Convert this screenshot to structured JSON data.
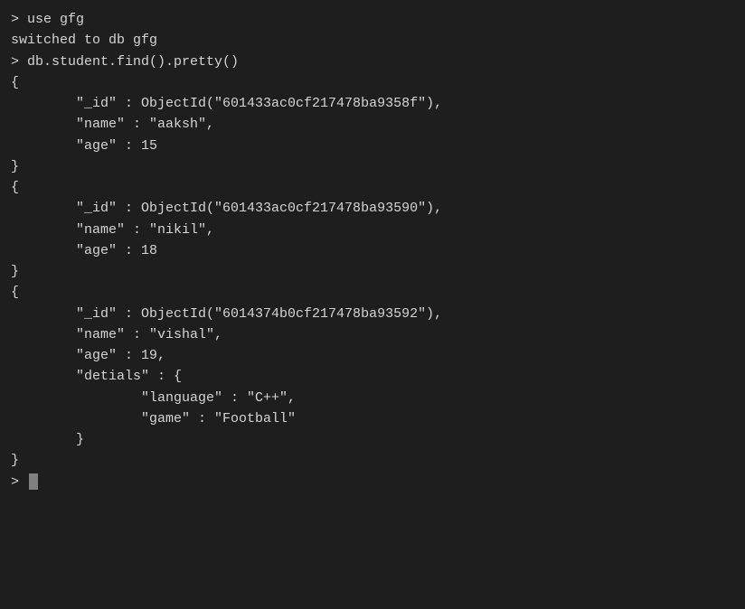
{
  "terminal": {
    "lines": [
      {
        "id": "line1",
        "content": "> use gfg"
      },
      {
        "id": "line2",
        "content": "switched to db gfg"
      },
      {
        "id": "line3",
        "content": "> db.student.find().pretty()"
      },
      {
        "id": "line4",
        "content": "{"
      },
      {
        "id": "line5",
        "content": "        \"_id\" : ObjectId(\"601433ac0cf217478ba9358f\"),"
      },
      {
        "id": "line6",
        "content": "        \"name\" : \"aaksh\","
      },
      {
        "id": "line7",
        "content": "        \"age\" : 15"
      },
      {
        "id": "line8",
        "content": ""
      },
      {
        "id": "line9",
        "content": "}"
      },
      {
        "id": "line10",
        "content": "{"
      },
      {
        "id": "line11",
        "content": ""
      },
      {
        "id": "line12",
        "content": "        \"_id\" : ObjectId(\"601433ac0cf217478ba93590\"),"
      },
      {
        "id": "line13",
        "content": "        \"name\" : \"nikil\","
      },
      {
        "id": "line14",
        "content": "        \"age\" : 18"
      },
      {
        "id": "line15",
        "content": ""
      },
      {
        "id": "line16",
        "content": "}"
      },
      {
        "id": "line17",
        "content": "{"
      },
      {
        "id": "line18",
        "content": ""
      },
      {
        "id": "line19",
        "content": "        \"_id\" : ObjectId(\"6014374b0cf217478ba93592\"),"
      },
      {
        "id": "line20",
        "content": "        \"name\" : \"vishal\","
      },
      {
        "id": "line21",
        "content": "        \"age\" : 19,"
      },
      {
        "id": "line22",
        "content": "        \"detials\" : {"
      },
      {
        "id": "line23",
        "content": "                \"language\" : \"C++\","
      },
      {
        "id": "line24",
        "content": "                \"game\" : \"Football\""
      },
      {
        "id": "line25",
        "content": "        }"
      },
      {
        "id": "line26",
        "content": "}"
      },
      {
        "id": "line27",
        "content": "> "
      }
    ]
  }
}
